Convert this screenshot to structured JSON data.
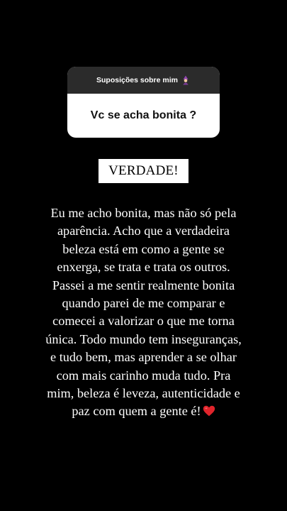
{
  "question_sticker": {
    "title": "Suposições sobre mim",
    "title_icon": "mage-emoji-icon",
    "question": "Vc se acha bonita ?"
  },
  "badge": {
    "text": "VERDADE!"
  },
  "caption": {
    "lines": [
      "Eu me acho bonita, mas não só pela",
      "aparência. Acho que a verdadeira",
      "beleza está em como a gente se",
      "enxerga, se trata e trata os outros.",
      "Passei a me sentir realmente bonita",
      "quando parei de me comparar e",
      "comecei a valorizar o que me torna",
      "única. Todo mundo tem inseguranças,",
      "e tudo bem, mas aprender a se olhar",
      "com mais carinho muda tudo. Pra",
      "mim, beleza é leveza, autenticidade e",
      "paz com quem a gente é!"
    ],
    "end_icon": "red-heart-icon"
  },
  "colors": {
    "background": "#000000",
    "card_header": "#2b2b2b",
    "card_body": "#ffffff",
    "heart": "#e0242b"
  }
}
